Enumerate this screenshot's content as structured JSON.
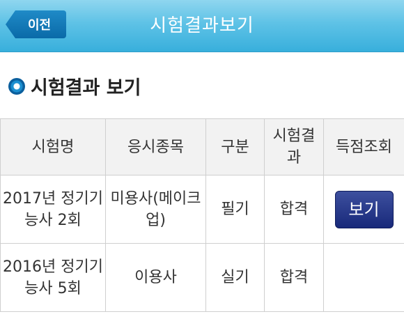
{
  "header": {
    "back_label": "이전",
    "title": "시험결과보기"
  },
  "section": {
    "title": "시험결과 보기"
  },
  "table": {
    "columns": [
      "시험명",
      "응시종목",
      "구분",
      "시험결과",
      "득점조회"
    ],
    "rows": [
      {
        "exam": "2017년 정기기능사 2회",
        "subject": "미용사(메이크업)",
        "type": "필기",
        "result": "합격",
        "action": "보기"
      },
      {
        "exam": "2016년 정기기능사 5회",
        "subject": "이용사",
        "type": "실기",
        "result": "합격",
        "action": ""
      }
    ]
  },
  "colors": {
    "header_bar": "#5ec2e6",
    "back_button": "#0a6aa8",
    "view_button": "#18297a"
  }
}
